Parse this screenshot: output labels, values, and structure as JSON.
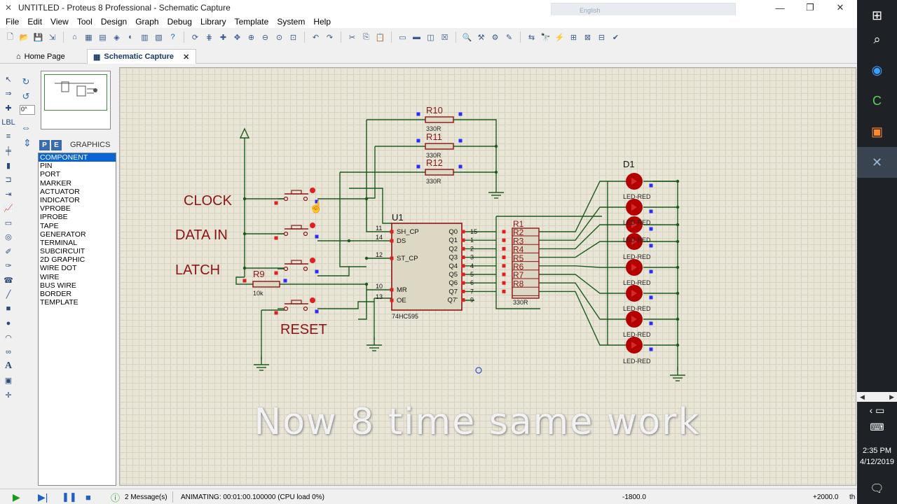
{
  "window": {
    "title": "UNTITLED - Proteus 8 Professional - Schematic Capture",
    "ghost_text": "English"
  },
  "menu": [
    "File",
    "Edit",
    "View",
    "Tool",
    "Design",
    "Graph",
    "Debug",
    "Library",
    "Template",
    "System",
    "Help"
  ],
  "tabs": [
    {
      "label": "Home Page",
      "active": false
    },
    {
      "label": "Schematic Capture",
      "active": true
    }
  ],
  "rotation_input": "0°",
  "selector": {
    "mode_label": "GRAPHICS",
    "items": [
      "COMPONENT",
      "PIN",
      "PORT",
      "MARKER",
      "ACTUATOR",
      "INDICATOR",
      "VPROBE",
      "IPROBE",
      "TAPE",
      "GENERATOR",
      "TERMINAL",
      "SUBCIRCUIT",
      "2D GRAPHIC",
      "WIRE DOT",
      "WIRE",
      "BUS WIRE",
      "BORDER",
      "TEMPLATE"
    ],
    "selected": "COMPONENT"
  },
  "schematic": {
    "labels": {
      "clock": "CLOCK",
      "data_in": "DATA IN",
      "latch": "LATCH",
      "reset": "RESET"
    },
    "ic": {
      "ref": "U1",
      "part": "74HC595",
      "left_pins": [
        {
          "num": "11",
          "name": "SH_CP"
        },
        {
          "num": "14",
          "name": "DS"
        },
        {
          "num": "12",
          "name": "ST_CP"
        },
        {
          "num": "10",
          "name": "MR"
        },
        {
          "num": "13",
          "name": "OE"
        }
      ],
      "right_pins": [
        {
          "num": "15",
          "name": "Q0"
        },
        {
          "num": "1",
          "name": "Q1"
        },
        {
          "num": "2",
          "name": "Q2"
        },
        {
          "num": "3",
          "name": "Q3"
        },
        {
          "num": "4",
          "name": "Q4"
        },
        {
          "num": "5",
          "name": "Q5"
        },
        {
          "num": "6",
          "name": "Q6"
        },
        {
          "num": "7",
          "name": "Q7"
        },
        {
          "num": "9",
          "name": "Q7'"
        }
      ]
    },
    "resistors_top": [
      {
        "ref": "R10",
        "value": "330R"
      },
      {
        "ref": "R11",
        "value": "330R"
      },
      {
        "ref": "R12",
        "value": "330R"
      }
    ],
    "r9": {
      "ref": "R9",
      "value": "10k"
    },
    "rpack": {
      "refs": [
        "R1",
        "R2",
        "R3",
        "R4",
        "R5",
        "R6",
        "R7",
        "R8"
      ],
      "value": "330R"
    },
    "led_ref": "D1",
    "led_part": "LED-RED",
    "led_labels": [
      "LED-RED",
      "LED-RED",
      "LED-RED",
      "LED-RED",
      "LED-RED",
      "LED-RED",
      "LED-RED"
    ]
  },
  "caption": "Now 8 time same work",
  "status": {
    "messages": "2 Message(s)",
    "animating": "ANIMATING: 00:01:00.100000 (CPU load 0%)",
    "coord_x": "-1800.0",
    "coord_y": "+2000.0",
    "units": "th"
  },
  "taskbar": {
    "time": "2:35 PM",
    "date": "4/12/2019"
  },
  "colors": {
    "wire": "#1c5a1c",
    "component": "#8c1414",
    "ic_fill": "#ddd8c4",
    "led": "#b40000",
    "label": "#8c1414",
    "pin_blue": "#2a2aff",
    "pin_red": "#e02020"
  }
}
